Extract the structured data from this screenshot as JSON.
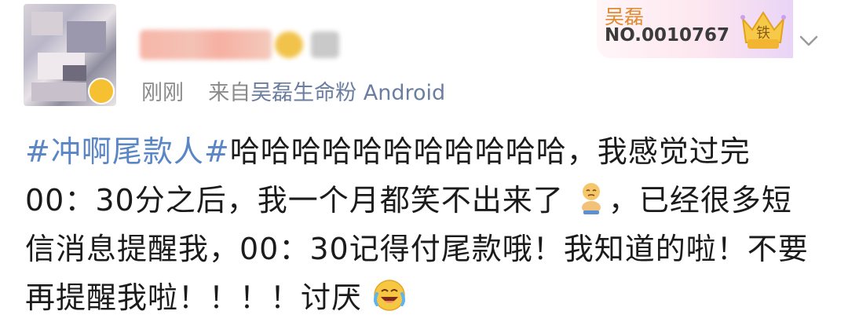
{
  "user": {
    "avatar_icon": "blurred-avatar",
    "verified_icon": "verified-badge-icon",
    "time": "刚刚",
    "source_prefix": "来自",
    "source_app": "吴磊生命粉 Android"
  },
  "fan_card": {
    "name": "吴磊",
    "number": "NO.0010767",
    "level": "铁"
  },
  "post": {
    "hashtag": "#冲啊尾款人#",
    "segment1": "哈哈哈哈哈哈哈哈哈哈哈，我感觉过完00：30分之后，我一个月都笑不出来了",
    "segment2": "，已经很多短信消息提醒我，00：30记得付尾款哦！我知道的啦！不要再提醒我啦！！！！讨厌",
    "emoji1": "cry-sitting-emoji",
    "emoji2": "laugh-cry-emoji"
  },
  "colors": {
    "hashtag": "#5a86c5",
    "meta": "#8a8a8a",
    "fan_name": "#e08a2e"
  }
}
